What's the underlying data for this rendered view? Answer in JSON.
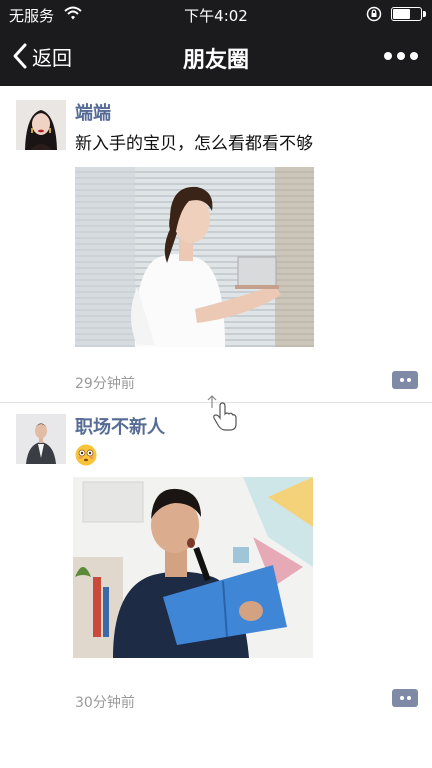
{
  "status_bar": {
    "carrier": "无服务",
    "time": "下午4:02",
    "battery_level": 0.62
  },
  "nav": {
    "back_label": "返回",
    "title": "朋友圈"
  },
  "posts": [
    {
      "author": "端端",
      "text": "新入手的宝贝，怎么看都看不够",
      "time": "29分钟前"
    },
    {
      "author": "职场不新人",
      "emoji": "😳",
      "time": "30分钟前"
    }
  ],
  "colors": {
    "nav_background": "#1b1b1d",
    "author_name": "#566b95",
    "timestamp": "#9a9a9a",
    "comment_button": "#7e8aa6"
  }
}
